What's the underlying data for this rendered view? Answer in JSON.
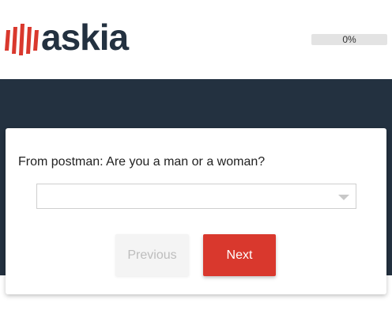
{
  "header": {
    "logo_text": "askia",
    "brand_color": "#d9382d",
    "dark_color": "#233140"
  },
  "progress": {
    "label": "0%",
    "value": 0
  },
  "survey": {
    "question": "From postman: Are you a man or a woman?",
    "dropdown_value": "",
    "dropdown_icon": "chevron-down-icon"
  },
  "navigation": {
    "previous_label": "Previous",
    "next_label": "Next"
  }
}
